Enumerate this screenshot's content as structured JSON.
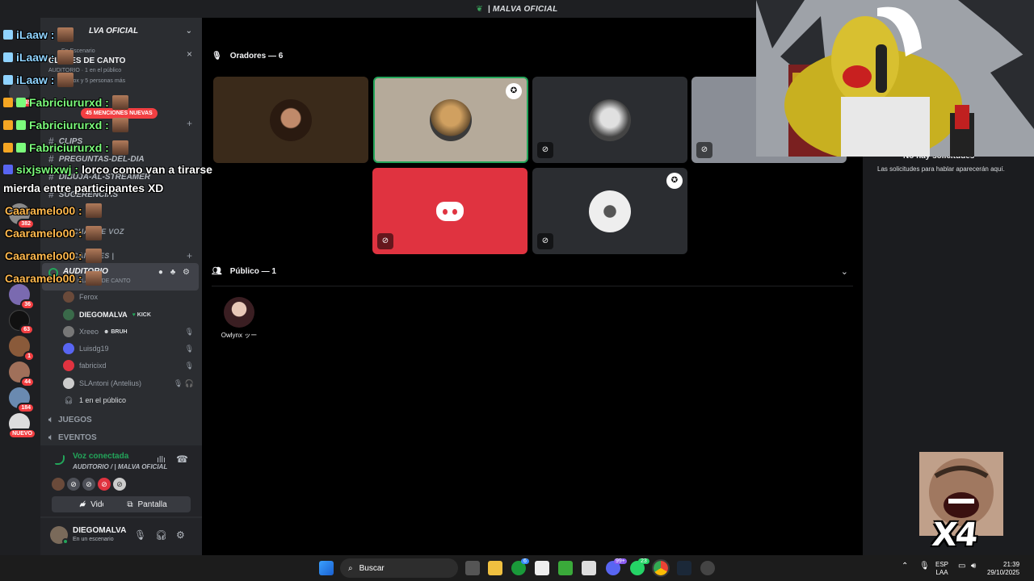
{
  "window": {
    "title": "| MALVA OFICIAL"
  },
  "sidebar": {
    "server_name": "LVA OFICIAL",
    "event": {
      "tag": "En Escenario",
      "title": "CLASES DE CANTO",
      "subtitle": "AUDITORIO · 1 en el público",
      "members": "Ferox y 5 personas más",
      "close": "×"
    },
    "mentions_badge": "45 MENCIONES NUEVAS",
    "channels": [
      {
        "name": "CLIPS"
      },
      {
        "name": "PREGUNTAS-DEL-DIA"
      },
      {
        "name": "DIBUJA-AL-STREAMER"
      },
      {
        "name": "SUGERENCIAS"
      }
    ],
    "voice_category": "CHAT DE VOZ",
    "categories": {
      "a": "CHAT DE VOZ",
      "b": "CANALES |"
    },
    "active_voice": {
      "name": "AUDITORIO",
      "sub": "CLASES DE CANTO"
    },
    "members": [
      {
        "name": "Ferox",
        "online": false,
        "tag": "",
        "muted": ""
      },
      {
        "name": "DIEGOMALVA",
        "online": true,
        "tag": "KICK",
        "muted": ""
      },
      {
        "name": "Xreeo",
        "online": false,
        "tag": "BRUH",
        "muted": "🎙"
      },
      {
        "name": "Luisdg19",
        "online": false,
        "tag": "",
        "muted": "🎙"
      },
      {
        "name": "fabricixd",
        "online": false,
        "tag": "",
        "muted": "🎙"
      },
      {
        "name": "SLAntoni (Antelius)",
        "online": false,
        "tag": "",
        "muted": "🎙 🎧"
      }
    ],
    "audience_count": "1 en el público",
    "voice_channels": [
      {
        "name": "JUEGOS"
      },
      {
        "name": "EVENTOS"
      }
    ],
    "server_badges": [
      "45",
      "382",
      "36",
      "63",
      "1",
      "44",
      "184",
      "NUEVO"
    ]
  },
  "voice_panel": {
    "status": "Voz conectada",
    "location": "AUDITORIO / | MALVA OFICIAL",
    "video_label": "Video",
    "screen_label": "Pantalla"
  },
  "user": {
    "name": "DIEGOMALVA",
    "status": "En un escenario"
  },
  "stage": {
    "speakers_header": "Oradores — 6",
    "audience_header": "Público — 1",
    "audience": [
      {
        "name": "Owlynx ッー"
      }
    ]
  },
  "right_panel": {
    "title": "No hay solicitudes",
    "text": "Las solicitudes para hablar aparecerán aquí."
  },
  "chat_overlay": [
    {
      "user": "iLaaw :",
      "msg": "",
      "color": "t"
    },
    {
      "user": "iLaaw :",
      "msg": "",
      "color": "t"
    },
    {
      "user": "iLaaw :",
      "msg": "",
      "color": "t"
    },
    {
      "user": "Fabriciururxd :",
      "msg": "",
      "color": "g"
    },
    {
      "user": "Fabriciururxd :",
      "msg": "",
      "color": "g"
    },
    {
      "user": "Fabriciururxd :",
      "msg": "",
      "color": "g"
    },
    {
      "user": "sixjswixwj :",
      "msg": "lorco como van a tirarse",
      "color": "g"
    },
    {
      "user": "",
      "msg": "mierda entre participantes XD",
      "color": "g"
    },
    {
      "user": "Caaramelo00 :",
      "msg": "",
      "color": "o"
    },
    {
      "user": "Caaramelo00 :",
      "msg": "",
      "color": "o"
    },
    {
      "user": "Caaramelo00 :",
      "msg": "",
      "color": "o"
    },
    {
      "user": "Caaramelo00 :",
      "msg": "",
      "color": "o"
    }
  ],
  "meme": {
    "caption": "X4"
  },
  "taskbar": {
    "search_placeholder": "Buscar",
    "badges": {
      "xbox": "6",
      "discord": "99+",
      "whatsapp": "23"
    },
    "lang_top": "ESP",
    "lang_bottom": "LAA",
    "time": "21:39",
    "date": "29/10/2025"
  },
  "colors": {
    "discord_blurple": "#5865f2",
    "tile_red": "#e03340",
    "online_green": "#23a55a",
    "mention_red": "#f23f42"
  }
}
